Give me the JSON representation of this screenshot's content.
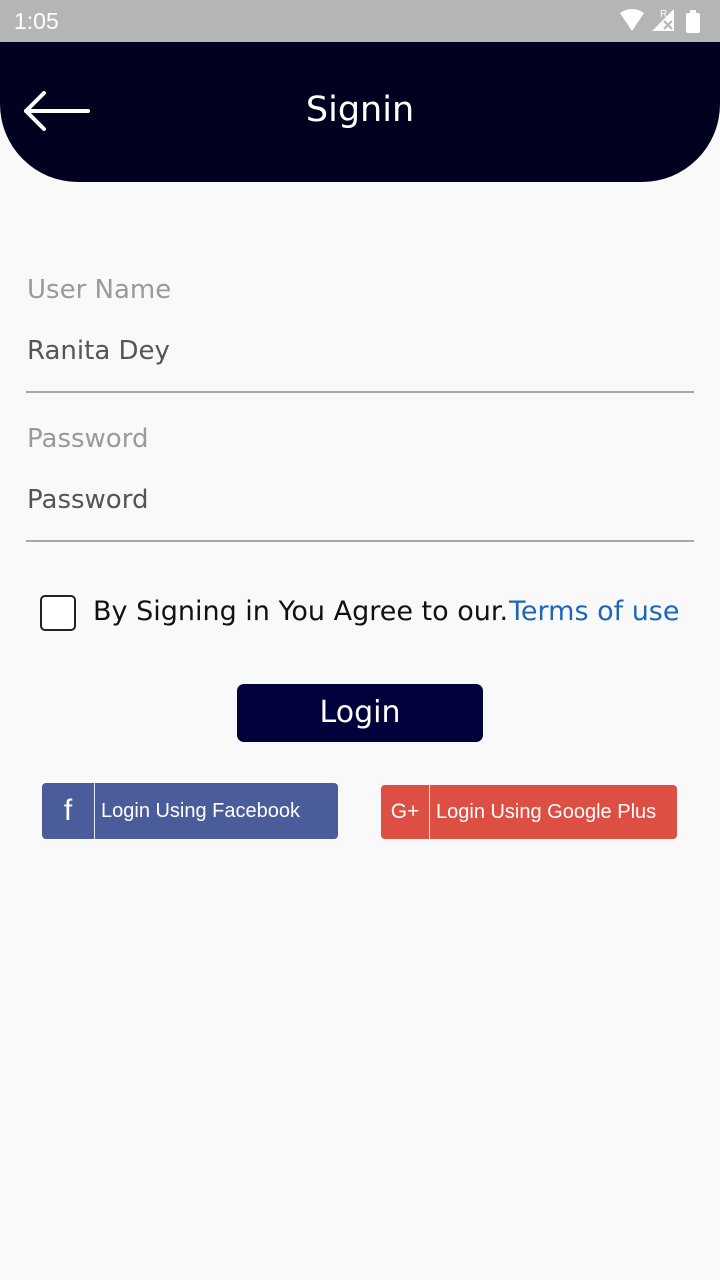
{
  "status_bar": {
    "time": "1:05",
    "icons": [
      "wifi-icon",
      "signal-icon",
      "battery-icon"
    ],
    "roaming_mark": "R"
  },
  "header": {
    "title": "Signin",
    "back_icon": "arrow-left-icon"
  },
  "form": {
    "username": {
      "label": "User Name",
      "value": "Ranita Dey"
    },
    "password": {
      "label": "Password",
      "placeholder": "Password"
    }
  },
  "terms": {
    "checked": false,
    "text": "By Signing in You Agree to our.",
    "link": "Terms of use"
  },
  "login_button": "Login",
  "social": {
    "facebook": {
      "icon_text": "f",
      "label": "Login Using Facebook"
    },
    "google": {
      "icon_text": "G+",
      "label": "Login Using Google Plus"
    }
  },
  "colors": {
    "header_bg": "#01021f",
    "login_bg": "#01023c",
    "link": "#1e67b6",
    "facebook": "#4b5c9b",
    "google": "#dd4e43"
  }
}
